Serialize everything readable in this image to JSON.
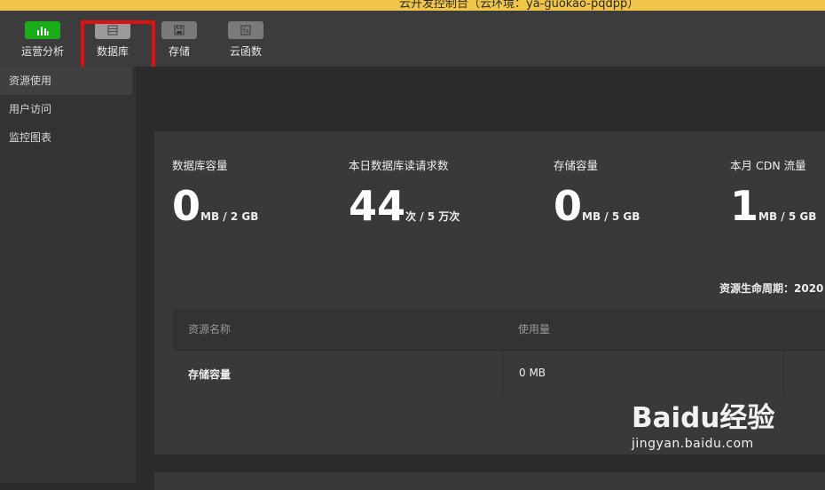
{
  "titlebar": {
    "title": "云开发控制台（云环境：ya-guokao-pqdpp）"
  },
  "toolbar": {
    "items": [
      {
        "label": "运营分析",
        "icon": "bar-chart-icon"
      },
      {
        "label": "数据库",
        "icon": "database-icon"
      },
      {
        "label": "存储",
        "icon": "save-icon"
      },
      {
        "label": "云函数",
        "icon": "function-icon"
      }
    ],
    "selected": "数据库",
    "accent_color": "#1aad19",
    "highlight_color": "#e01010"
  },
  "sidebar": {
    "items": [
      {
        "label": "资源使用",
        "active": true
      },
      {
        "label": "用户访问"
      },
      {
        "label": "监控图表"
      }
    ]
  },
  "stats": [
    {
      "title": "数据库容量",
      "value": "0",
      "unit": "MB / 2 GB"
    },
    {
      "title": "本日数据库读请求数",
      "value": "44",
      "unit": "次 / 5 万次"
    },
    {
      "title": "存储容量",
      "value": "0",
      "unit": "MB / 5 GB"
    },
    {
      "title": "本月 CDN 流量",
      "value": "1",
      "unit": "MB / 5 GB"
    }
  ],
  "cycle_label": "资源生命周期：2020",
  "table": {
    "headers": [
      "资源名称",
      "使用量"
    ],
    "rows": [
      {
        "name": "存储容量",
        "usage": "0 MB"
      }
    ]
  },
  "watermark": {
    "brand": "Baidu经验",
    "url": "jingyan.baidu.com"
  }
}
